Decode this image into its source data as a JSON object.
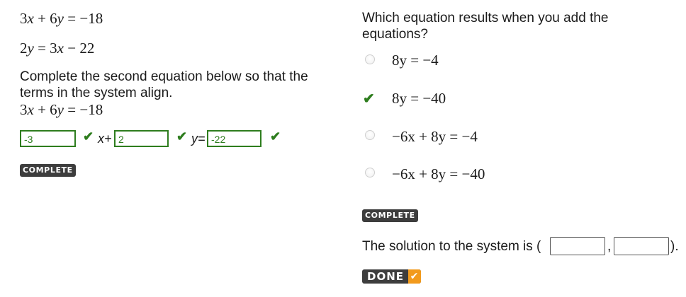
{
  "left": {
    "eq1": {
      "a": "3",
      "b": "6",
      "rhs": "18"
    },
    "eq2": {
      "lhs": "2",
      "a": "3",
      "rhs": "22"
    },
    "prompt": "Complete the second equation below so that the terms in the system align.",
    "eq3": {
      "a": "3",
      "b": "6",
      "rhs": "18"
    },
    "answers": {
      "x_coef": "-3",
      "y_coef": "2",
      "const": "-22"
    },
    "x_plus": "x+",
    "y_eq": "y=",
    "status": "COMPLETE"
  },
  "right": {
    "question": "Which equation results when you add the equations?",
    "options": [
      {
        "text": "8y = −4",
        "selected": false
      },
      {
        "text": "8y = −40",
        "selected": true
      },
      {
        "text": "−6x + 8y = −4",
        "selected": false
      },
      {
        "text": "−6x + 8y = −40",
        "selected": false
      }
    ],
    "status": "COMPLETE",
    "solution": {
      "prefix": "The solution to the system is (",
      "comma": ",",
      "suffix": ")."
    },
    "done_label": "DONE",
    "colors": {
      "correct": "#2e7d1e",
      "badge": "#3d3d3d",
      "done_accent": "#f29a1c"
    }
  }
}
